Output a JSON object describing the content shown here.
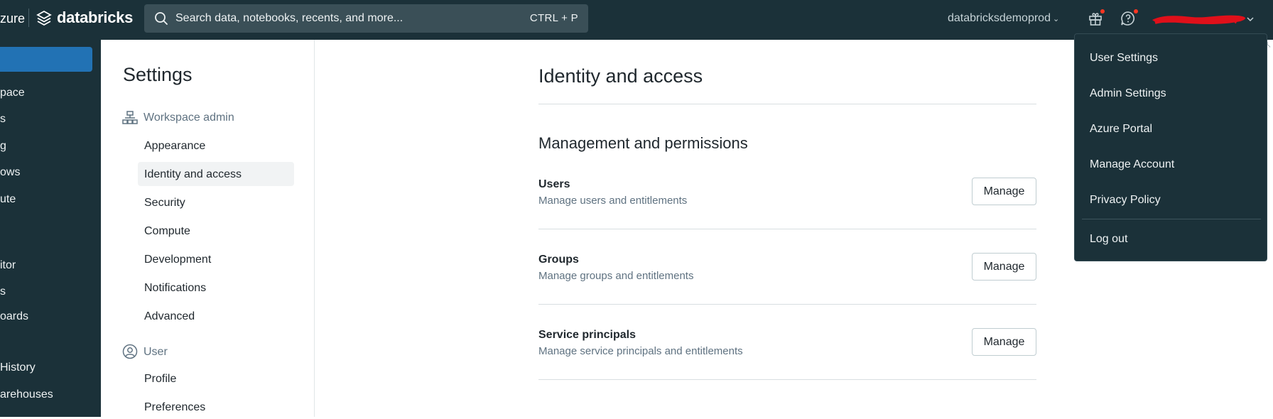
{
  "topbar": {
    "brand_prefix": "zure",
    "brand_name": "databricks",
    "search_placeholder": "Search data, notebooks, recents, and more...",
    "search_shortcut": "CTRL + P",
    "workspace_name": "databricksdemoprod",
    "icons": [
      "search-icon",
      "gift-icon",
      "help-icon",
      "chevron-down-icon"
    ],
    "notification_color": "#ff3621"
  },
  "leftnav": {
    "items": [
      "pace",
      "s",
      "g",
      "ows",
      "ute",
      "itor",
      "s",
      "oards",
      "History",
      "arehouses"
    ]
  },
  "settings": {
    "title": "Settings",
    "workspace_admin": {
      "label": "Workspace admin",
      "items": [
        "Appearance",
        "Identity and access",
        "Security",
        "Compute",
        "Development",
        "Notifications",
        "Advanced"
      ]
    },
    "user": {
      "label": "User",
      "items": [
        "Profile",
        "Preferences"
      ]
    },
    "active_item": "Identity and access"
  },
  "main": {
    "title": "Identity and access",
    "section_title": "Management and permissions",
    "rows": [
      {
        "title": "Users",
        "desc": "Manage users and entitlements",
        "button": "Manage"
      },
      {
        "title": "Groups",
        "desc": "Manage groups and entitlements",
        "button": "Manage"
      },
      {
        "title": "Service principals",
        "desc": "Manage service principals and entitlements",
        "button": "Manage"
      }
    ]
  },
  "dropdown": {
    "items": [
      "User Settings",
      "Admin Settings",
      "Azure Portal",
      "Manage Account",
      "Privacy Policy"
    ],
    "logout": "Log out"
  },
  "colors": {
    "topbar_bg": "#1b3139",
    "accent": "#2272b4",
    "redaction": "#e0101a"
  }
}
